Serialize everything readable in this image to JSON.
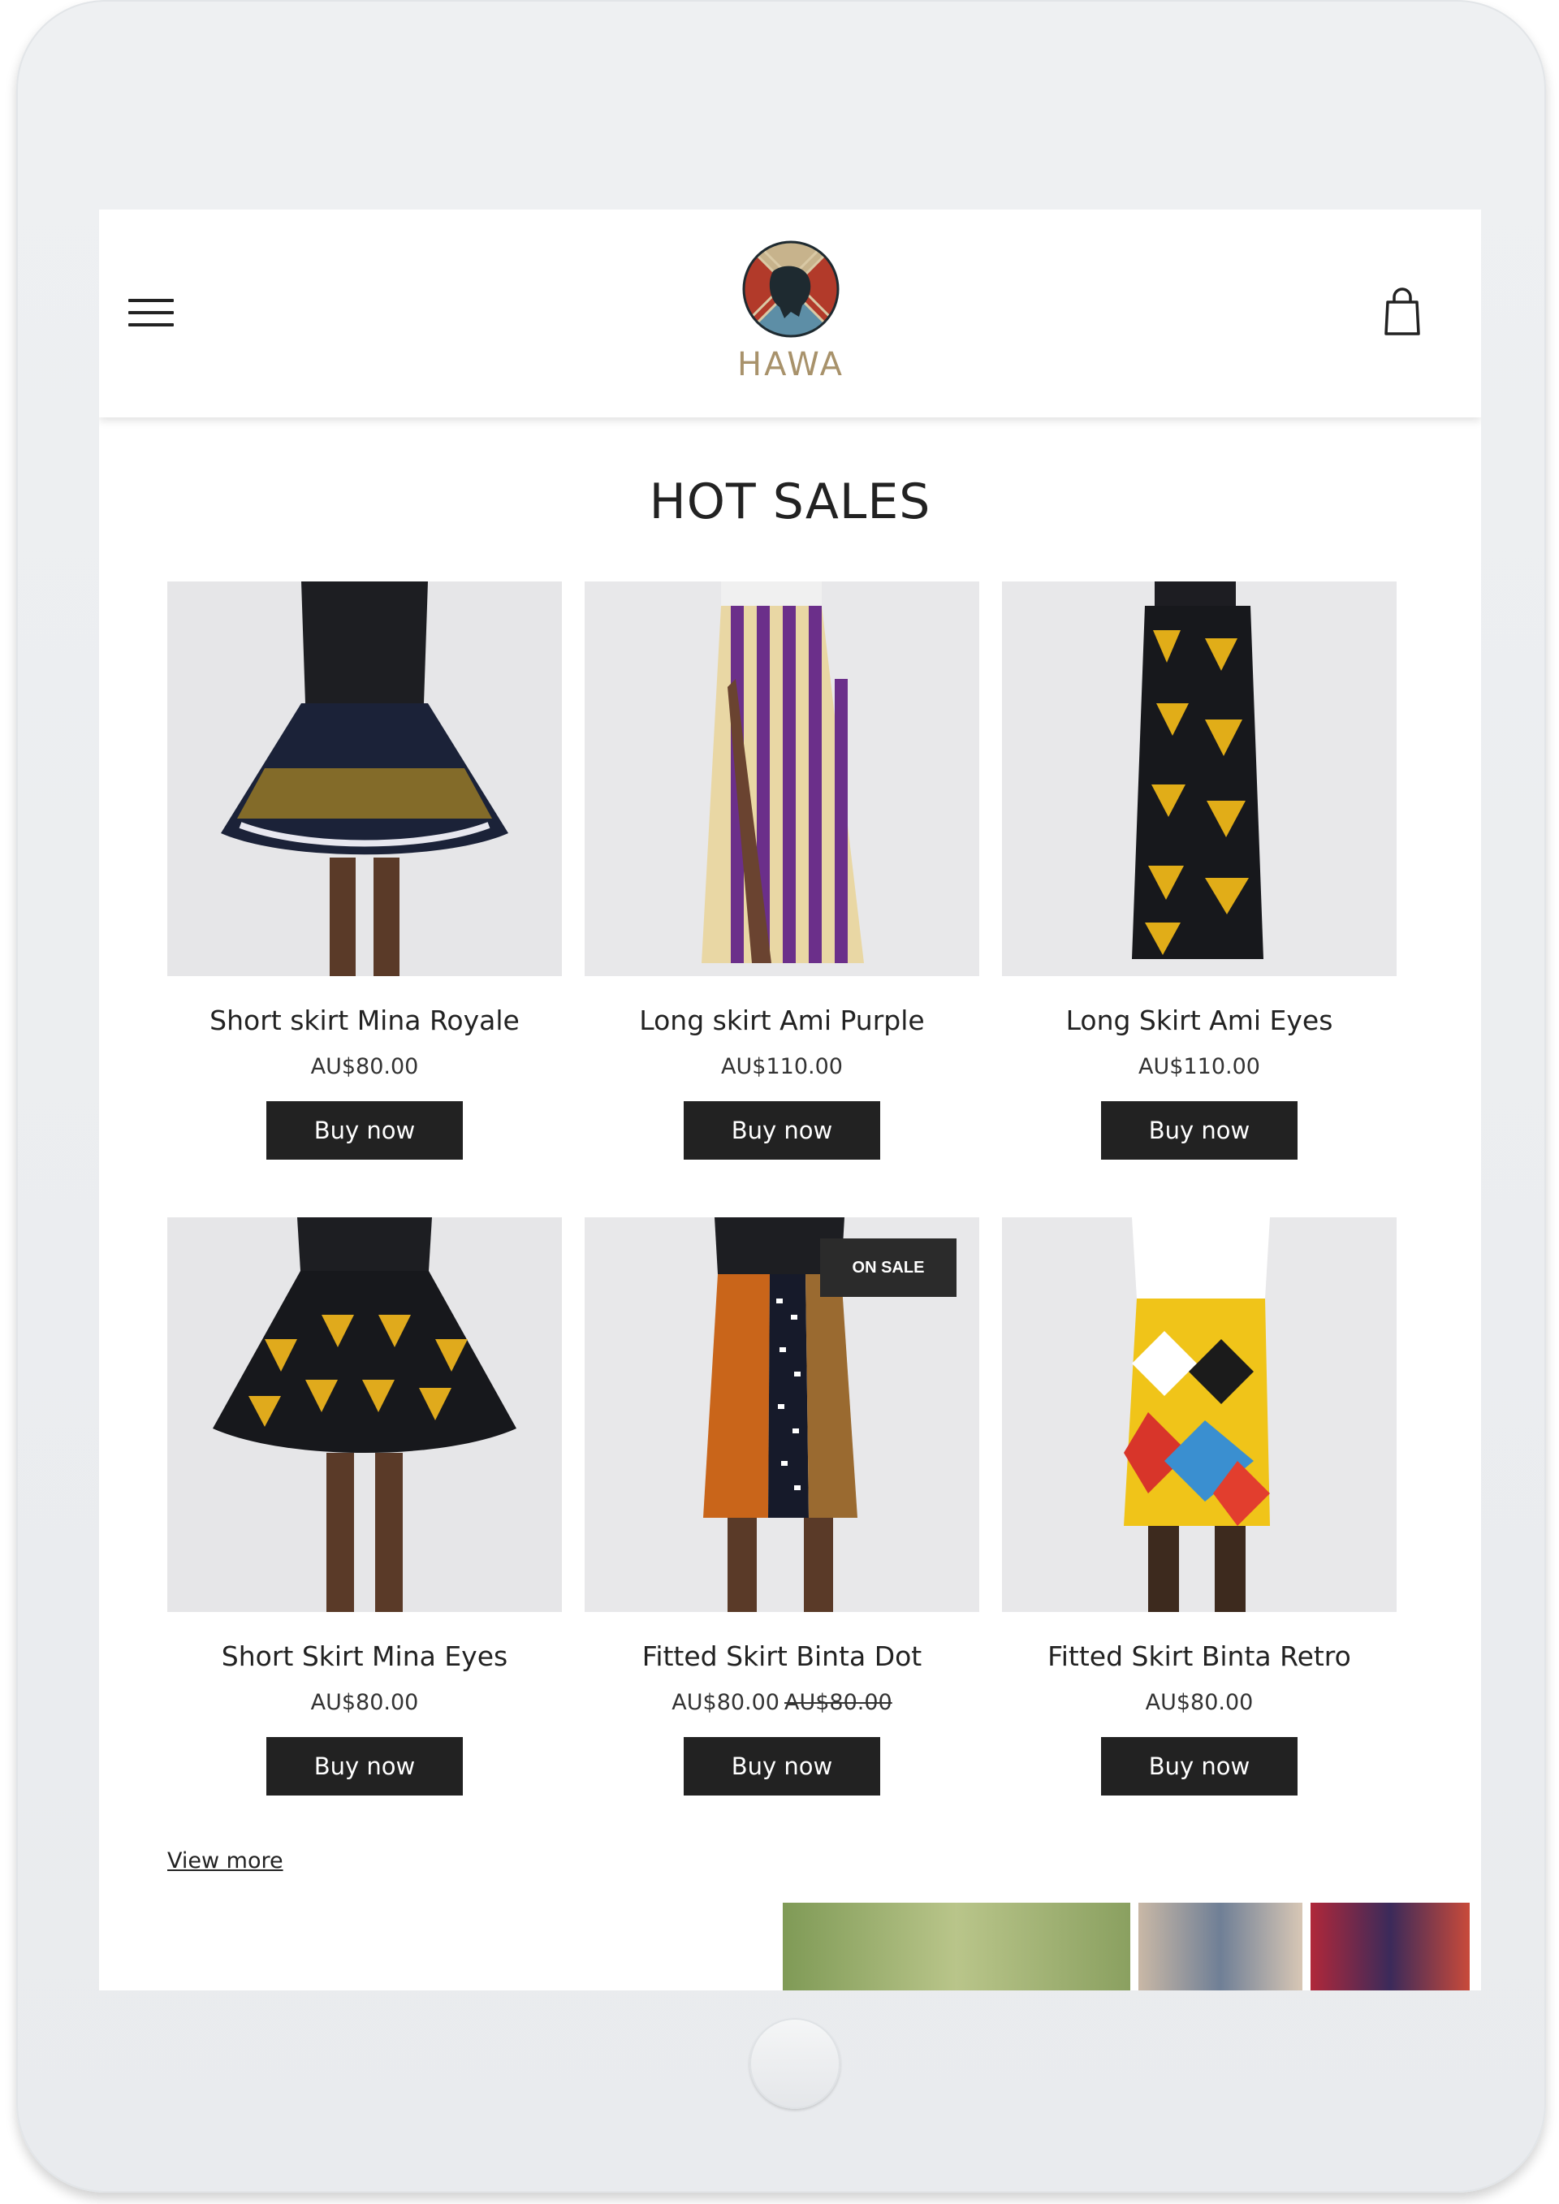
{
  "header": {
    "menu_icon": "hamburger-menu-icon",
    "brand": "HAWA",
    "cart_icon": "shopping-bag-icon"
  },
  "section": {
    "title": "HOT SALES"
  },
  "products": [
    {
      "name": "Short skirt Mina Royale",
      "price": "AU$80.00",
      "button": "Buy now"
    },
    {
      "name": "Long skirt Ami Purple",
      "price": "AU$110.00",
      "button": "Buy now"
    },
    {
      "name": "Long Skirt Ami Eyes",
      "price": "AU$110.00",
      "button": "Buy now"
    },
    {
      "name": "Short Skirt Mina Eyes",
      "price": "AU$80.00",
      "button": "Buy now"
    },
    {
      "name": "Fitted Skirt Binta Dot",
      "price": "AU$80.00",
      "old_price": "AU$80.00",
      "badge": "ON SALE",
      "button": "Buy now"
    },
    {
      "name": "Fitted Skirt Binta Retro",
      "price": "AU$80.00",
      "button": "Buy now"
    }
  ],
  "footer": {
    "view_more": "View more"
  },
  "colors": {
    "button_bg": "#222222",
    "logo_gold": "#a8926b",
    "logo_blue": "#3e6e86",
    "logo_red": "#b23a2a"
  }
}
